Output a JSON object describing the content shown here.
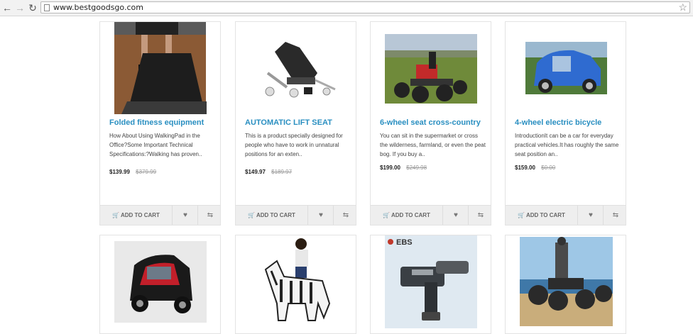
{
  "browser": {
    "url": "www.bestgoodsgo.com",
    "back_icon": "arrow-left-icon",
    "forward_icon": "arrow-right-icon",
    "reload_icon": "reload-icon",
    "star_icon": "star-icon"
  },
  "labels": {
    "add_to_cart": "ADD TO CART"
  },
  "products": [
    {
      "title": "Folded fitness equipment",
      "description": "How About Using WalkingPad in the Office?Some Important Technical Specifications:?Walking has proven..",
      "price": "$139.99",
      "old_price": "$379.99"
    },
    {
      "title": "AUTOMATIC LIFT SEAT",
      "description": "This is a product specially designed for people who have to work in unnatural positions for an exten..",
      "price": "$149.97",
      "old_price": "$189.97"
    },
    {
      "title": "6-wheel seat cross-country",
      "description": "You can sit in the supermarket or cross the wilderness, farmland, or even the peat bog. If you buy a..",
      "price": "$199.00",
      "old_price": "$249.98"
    },
    {
      "title": "4-wheel electric bicycle",
      "description": "IntroductionIt can be a car for everyday practical vehicles.It has roughly the same seat position an..",
      "price": "$159.00",
      "old_price": "$0.00"
    }
  ],
  "row2": {
    "ebs_logo_text": "EBS"
  },
  "colors": {
    "title": "#2a8fc1",
    "action_bar": "#eeeeee"
  }
}
